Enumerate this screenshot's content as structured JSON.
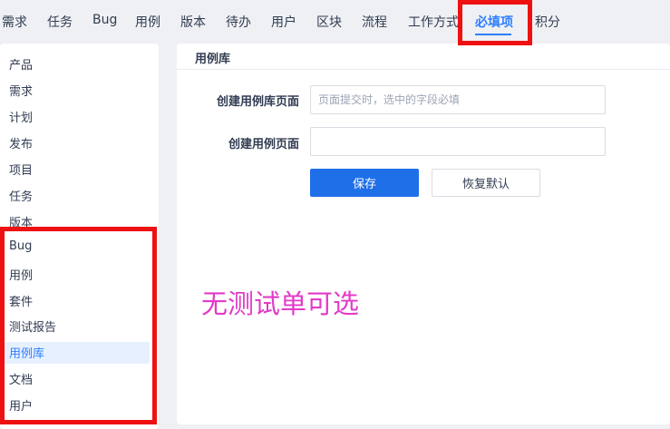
{
  "nav": {
    "items": [
      "需求",
      "任务",
      "Bug",
      "用例",
      "版本",
      "待办",
      "用户",
      "区块",
      "流程",
      "工作方式",
      "必填项",
      "积分"
    ],
    "active": "必填项"
  },
  "sidebar": {
    "items": [
      "产品",
      "需求",
      "计划",
      "发布",
      "项目",
      "任务",
      "版本",
      "Bug",
      "用例",
      "套件",
      "测试报告",
      "用例库",
      "文档",
      "用户"
    ],
    "active": "用例库"
  },
  "panel": {
    "title": "用例库",
    "fields": [
      {
        "label": "创建用例库页面",
        "value": "",
        "placeholder": "页面提交时，选中的字段必填"
      },
      {
        "label": "创建用例页面",
        "value": "",
        "placeholder": ""
      }
    ],
    "save_label": "保存",
    "reset_label": "恢复默认"
  },
  "annotation": "无测试单可选",
  "colors": {
    "accent": "#2e7fff",
    "highlight_box": "#ee1111",
    "annotation": "#e23ac8"
  }
}
